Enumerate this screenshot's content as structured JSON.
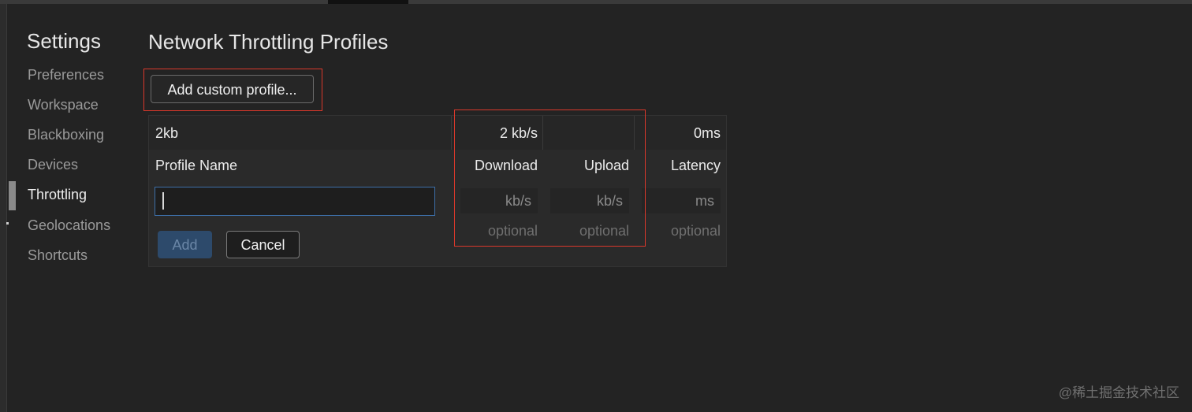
{
  "sidebar": {
    "title": "Settings",
    "items": [
      {
        "label": "Preferences",
        "active": false
      },
      {
        "label": "Workspace",
        "active": false
      },
      {
        "label": "Blackboxing",
        "active": false
      },
      {
        "label": "Devices",
        "active": false
      },
      {
        "label": "Throttling",
        "active": true
      },
      {
        "label": "Geolocations",
        "active": false
      },
      {
        "label": "Shortcuts",
        "active": false
      }
    ]
  },
  "main": {
    "title": "Network Throttling Profiles",
    "add_custom_label": "Add custom profile...",
    "existing_profile": {
      "name": "2kb",
      "download": "2 kb/s",
      "upload": "",
      "latency": "0ms"
    },
    "editor": {
      "headers": {
        "name": "Profile Name",
        "download": "Download",
        "upload": "Upload",
        "latency": "Latency"
      },
      "name_value": "",
      "download_unit": "kb/s",
      "upload_unit": "kb/s",
      "latency_unit": "ms",
      "download_hint": "optional",
      "upload_hint": "optional",
      "latency_hint": "optional",
      "add_label": "Add",
      "cancel_label": "Cancel"
    }
  },
  "watermark": "@稀土掘金技术社区",
  "colors": {
    "background": "#232323",
    "highlight_box": "#d9382b",
    "input_focus": "#3d6fa8"
  }
}
